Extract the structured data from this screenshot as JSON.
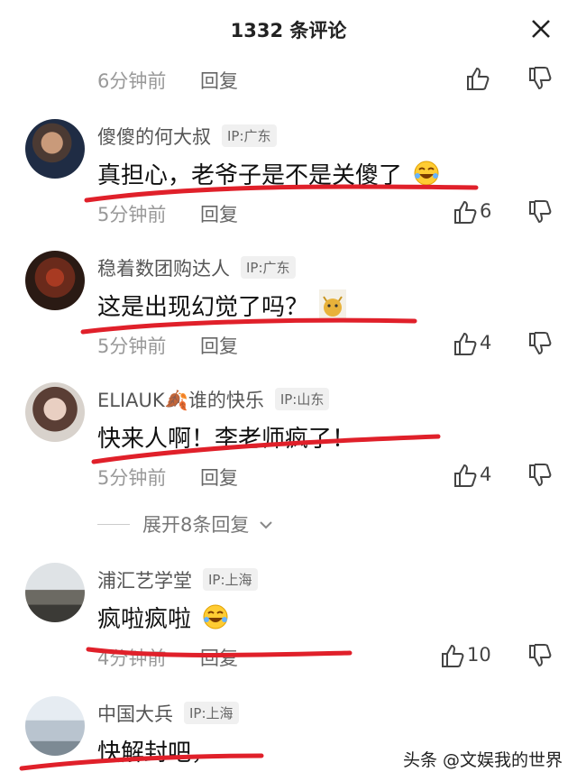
{
  "header": {
    "title": "1332 条评论",
    "close_label": "✕"
  },
  "first_comment": {
    "time": "6分钟前",
    "reply": "回复"
  },
  "comments": [
    {
      "user": "傻傻的何大叔",
      "ip": "IP:广东",
      "text": "真担心，老爷子是不是关傻了",
      "emoji": "laughing-tears-emoji",
      "time": "5分钟前",
      "reply": "回复",
      "likes": "6"
    },
    {
      "user": "稳着数团购达人",
      "ip": "IP:广东",
      "text": "这是出现幻觉了吗？",
      "emoji": "cat-emoji",
      "time": "5分钟前",
      "reply": "回复",
      "likes": "4"
    },
    {
      "user": "ELIAUK🍂谁的快乐",
      "ip": "IP:山东",
      "text": "快来人啊！李老师疯了！",
      "time": "5分钟前",
      "reply": "回复",
      "likes": "4"
    },
    {
      "user": "浦汇艺学堂",
      "ip": "IP:上海",
      "text": "疯啦疯啦",
      "emoji": "laughing-tears-emoji",
      "time": "4分钟前",
      "reply": "回复",
      "likes": "10"
    },
    {
      "user": "中国大兵",
      "ip": "IP:上海",
      "text": "快解封吧，"
    }
  ],
  "expand_replies": "展开8条回复",
  "watermark": "头条 @文娱我的世界",
  "colors": {
    "underline": "#e0202a",
    "meta_text": "#999999",
    "badge_bg": "#f0f0f0"
  }
}
